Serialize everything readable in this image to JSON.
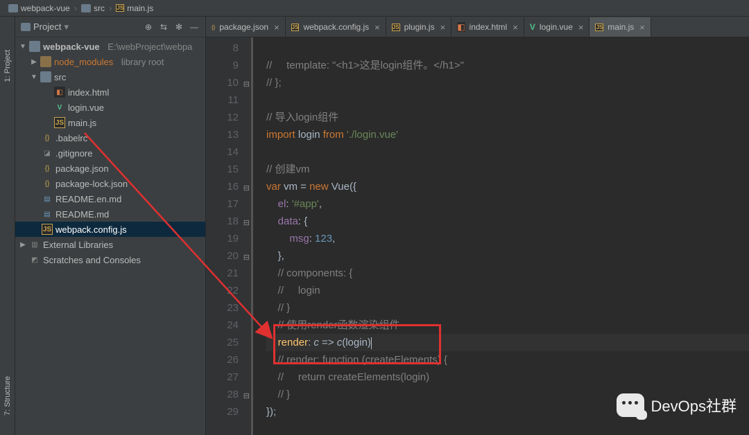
{
  "breadcrumb": {
    "root": "webpack-vue",
    "dir": "src",
    "file": "main.js"
  },
  "panel": {
    "title": "Project",
    "root": "webpack-vue",
    "rootPath": "E:\\webProject\\webpa",
    "node_modules": "node_modules",
    "library_root": "library root",
    "src": "src",
    "files": {
      "index_html": "index.html",
      "login_vue": "login.vue",
      "main_js": "main.js",
      "babelrc": ".babelrc",
      "gitignore": ".gitignore",
      "package_json": "package.json",
      "package_lock": "package-lock.json",
      "readme_en": "README.en.md",
      "readme": "README.md",
      "webpack_config": "webpack.config.js"
    },
    "external": "External Libraries",
    "scratches": "Scratches and Consoles"
  },
  "sideTabs": {
    "project": "1: Project",
    "structure": "7: Structure"
  },
  "tabs": {
    "package": "package.json",
    "webpack": "webpack.config.js",
    "plugin": "plugin.js",
    "index": "index.html",
    "login": "login.vue",
    "main": "main.js"
  },
  "lines": {
    "l8": "8",
    "l9": "9",
    "l10": "10",
    "l11": "11",
    "l12": "12",
    "l13": "13",
    "l14": "14",
    "l15": "15",
    "l16": "16",
    "l17": "17",
    "l18": "18",
    "l19": "19",
    "l20": "20",
    "l21": "21",
    "l22": "22",
    "l23": "23",
    "l24": "24",
    "l25": "25",
    "l26": "26",
    "l27": "27",
    "l28": "28",
    "l29": "29"
  },
  "code": {
    "c9": "//     template: \"<h1>这是login组件。</h1>\"",
    "c10": "// };",
    "c12": "// 导入login组件",
    "c13a": "import",
    "c13b": " login ",
    "c13c": "from",
    "c13d": " './login.vue'",
    "c15": "// 创建vm",
    "c16a": "var",
    "c16b": " vm = ",
    "c16c": "new",
    "c16d": " Vue({",
    "c17a": "el",
    "c17b": ": ",
    "c17c": "'#app'",
    "c17d": ",",
    "c18a": "data",
    "c18b": ": {",
    "c19a": "msg",
    "c19b": ": ",
    "c19c": "123",
    "c19d": ",",
    "c20": "},",
    "c21": "// components: {",
    "c22": "//     login",
    "c23": "// }",
    "c24": "// 使用render函数渲染组件",
    "c25a": "render",
    "c25b": ": ",
    "c25c": "c",
    "c25d": " => ",
    "c25e": "c",
    "c25f": "(login)",
    "c26": "// render: function (createElements) {",
    "c27": "//     return createElements(login)",
    "c28": "// }",
    "c29": "});"
  },
  "watermark": "DevOps社群"
}
